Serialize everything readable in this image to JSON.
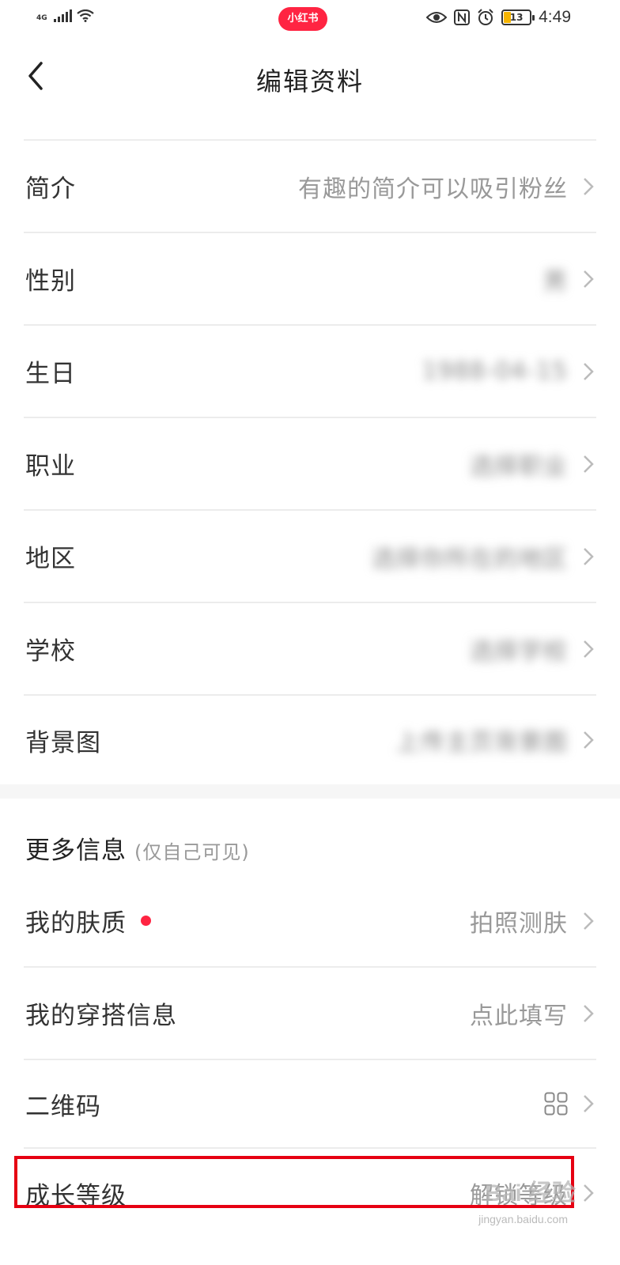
{
  "status_bar": {
    "network": "4G",
    "app_badge": "小红书",
    "battery": "13",
    "time": "4:49"
  },
  "header": {
    "title": "编辑资料"
  },
  "profile_rows": [
    {
      "label": "简介",
      "value": "有趣的简介可以吸引粉丝"
    },
    {
      "label": "性别",
      "value": "男"
    },
    {
      "label": "生日",
      "value": "1988-04-15"
    },
    {
      "label": "职业",
      "value": "选择职业"
    },
    {
      "label": "地区",
      "value": "选择你所在的地区"
    },
    {
      "label": "学校",
      "value": "选择学校"
    },
    {
      "label": "背景图",
      "value": "上传主页背景图"
    }
  ],
  "more_info": {
    "title": "更多信息",
    "subtitle": "(仅自己可见)",
    "rows": [
      {
        "label": "我的肤质",
        "value": "拍照测肤"
      },
      {
        "label": "我的穿搭信息",
        "value": "点此填写"
      },
      {
        "label": "二维码",
        "value": ""
      },
      {
        "label": "成长等级",
        "value": "解锁等级"
      }
    ]
  },
  "watermark": {
    "brand": "Bai 经验",
    "url": "jingyan.baidu.com"
  },
  "colors": {
    "accent": "#ff2442",
    "highlight": "#e60012",
    "label": "#333333",
    "value": "#999999"
  }
}
